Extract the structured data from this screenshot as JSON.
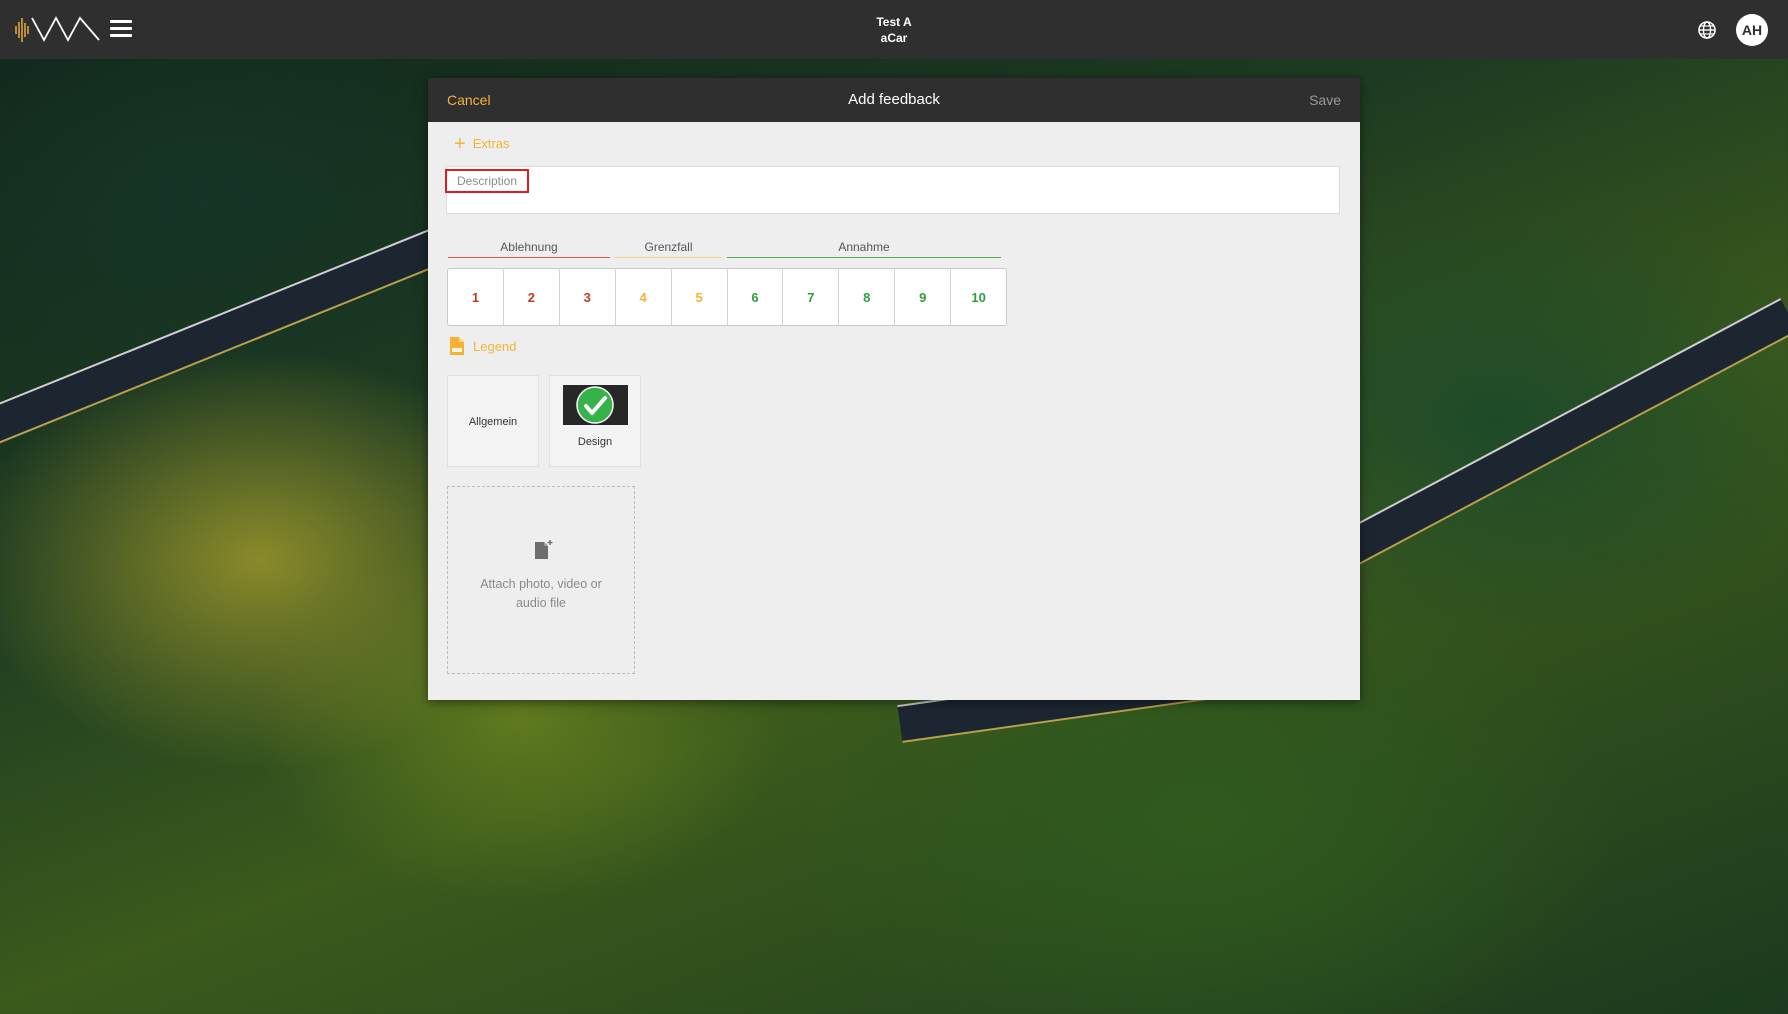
{
  "topbar": {
    "project_name": "Test A",
    "project_sub": "aCar",
    "avatar_initials": "AH"
  },
  "dialog": {
    "cancel_label": "Cancel",
    "title": "Add feedback",
    "save_label": "Save",
    "extras_label": "Extras",
    "description_label": "Description",
    "scale": {
      "groups": [
        {
          "label": "Ablehnung",
          "color": "#e05a4a"
        },
        {
          "label": "Grenzfall",
          "color": "#f2d27a"
        },
        {
          "label": "Annahme",
          "color": "#4caf50"
        }
      ],
      "ratings": [
        {
          "value": "1",
          "color": "#c0392b"
        },
        {
          "value": "2",
          "color": "#c0392b"
        },
        {
          "value": "3",
          "color": "#c0392b"
        },
        {
          "value": "4",
          "color": "#f5b335"
        },
        {
          "value": "5",
          "color": "#f5b335"
        },
        {
          "value": "6",
          "color": "#2e9e3e"
        },
        {
          "value": "7",
          "color": "#2e9e3e"
        },
        {
          "value": "8",
          "color": "#2e9e3e"
        },
        {
          "value": "9",
          "color": "#2e9e3e"
        },
        {
          "value": "10",
          "color": "#2e9e3e"
        }
      ]
    },
    "legend_label": "Legend",
    "categories": [
      {
        "label": "Allgemein",
        "icon": null
      },
      {
        "label": "Design",
        "icon": "green-check-icon"
      }
    ],
    "attach_label": "Attach photo, video or audio file"
  },
  "colors": {
    "accent": "#f5b335",
    "header_bg": "#2f2f2f",
    "dialog_bg": "#eeeeee"
  }
}
